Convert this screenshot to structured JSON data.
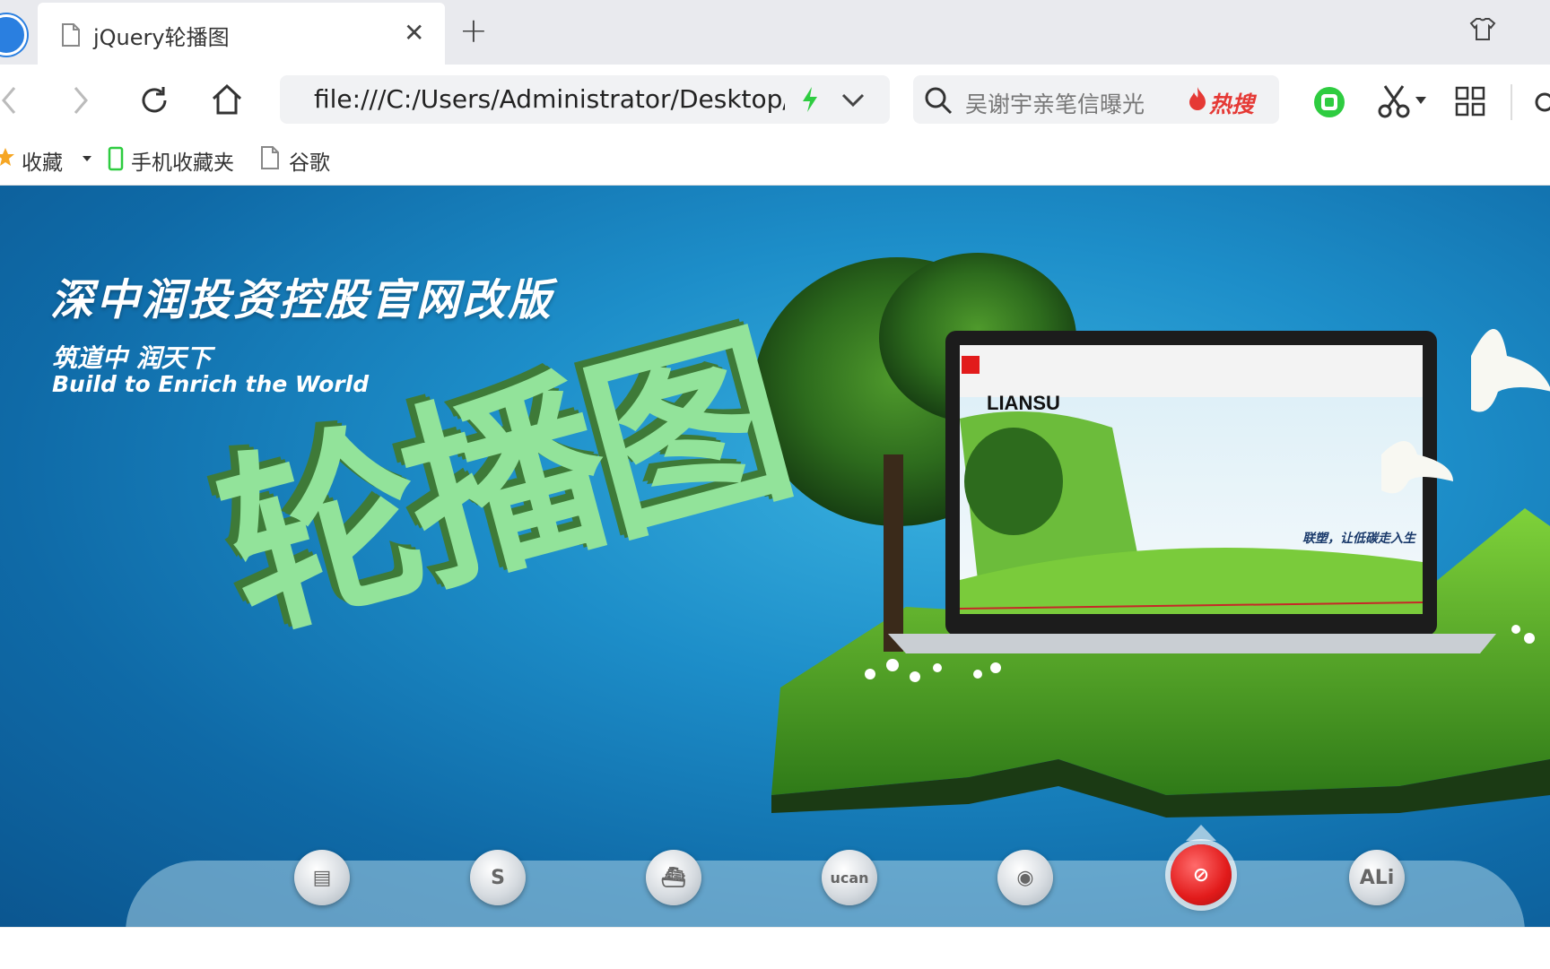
{
  "tab": {
    "title": "jQuery轮播图"
  },
  "toolbar": {
    "address": "file:///C:/Users/Administrator/Desktop/j",
    "search_placeholder": "吴谢宇亲笔信曝光",
    "hot": "热搜"
  },
  "bookmarks": [
    "收藏",
    "手机收藏夹",
    "谷歌"
  ],
  "banner": {
    "headline": "深中润投资控股官网改版",
    "sub_cn": "筑道中 润天下",
    "sub_en": "Build to Enrich the World",
    "overlay": "轮播图",
    "laptop_brand": "LIANSU",
    "laptop_tagline": "联塑，让低碳走入生"
  },
  "thumbs": [
    {
      "label": "▤"
    },
    {
      "label": "S"
    },
    {
      "label": "⛴"
    },
    {
      "label": "ucan"
    },
    {
      "label": "◉"
    },
    {
      "label": "⊘",
      "active": true
    },
    {
      "label": "ALi"
    }
  ],
  "colors": {
    "accent_green": "#92e39a",
    "banner_blue": "#1d8ec9",
    "hot_red": "#e53935"
  }
}
